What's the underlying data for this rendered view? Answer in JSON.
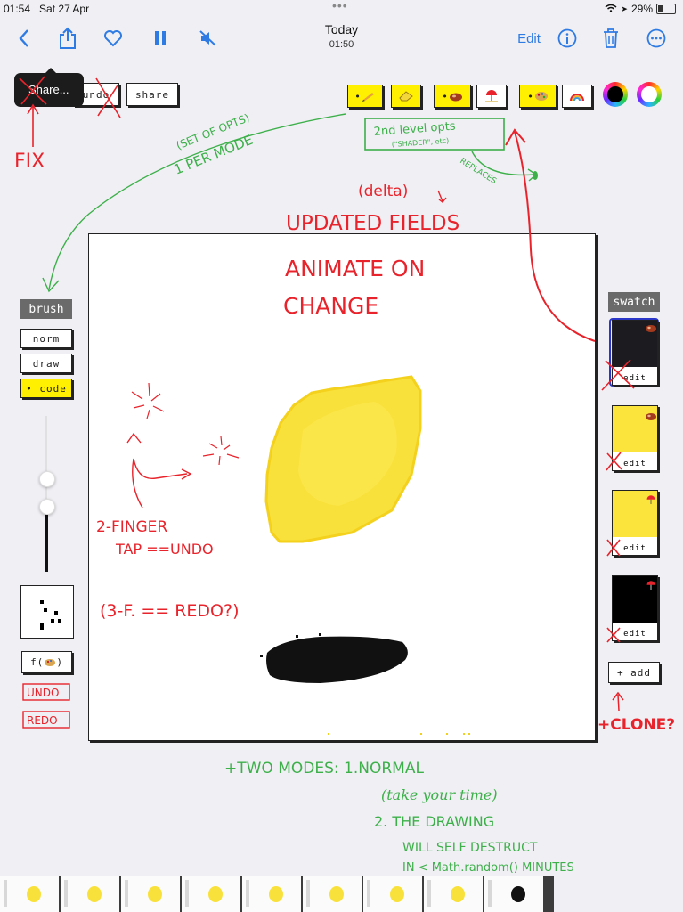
{
  "status_bar": {
    "time": "01:54",
    "date": "Sat 27 Apr",
    "battery": "29%"
  },
  "nav": {
    "title": "Today",
    "subtitle": "01:50",
    "edit_label": "Edit"
  },
  "tooltip": {
    "label": "Share..."
  },
  "toolbar": {
    "undo_label": "undo",
    "share_label": "share"
  },
  "mode_buttons": {
    "pencil": "•",
    "shader": "•",
    "meat": "•"
  },
  "left_panel": {
    "heading": "brush",
    "modes": [
      {
        "label": "norm"
      },
      {
        "label": "draw"
      },
      {
        "label": "• code"
      }
    ],
    "func_label": "f("
  },
  "right_panel": {
    "heading": "swatch",
    "swatches": [
      {
        "edit": "edit"
      },
      {
        "edit": "edit"
      },
      {
        "edit": "edit"
      },
      {
        "edit": "edit"
      }
    ],
    "add_label": "+ add"
  },
  "colors": {
    "accent": "#2f7be4",
    "lemon": "#f9e13b",
    "highlight": "#ffef00",
    "annotation_red": "#e8232b",
    "annotation_green": "#3db04a"
  },
  "annotations": {
    "fix": "FIX",
    "set_of_opts": "(SET OF OPTS)",
    "one_per_mode": "1 PER MODE",
    "second_level": "2nd level opts",
    "shader_etc": "(\"SHADER\", etc)",
    "replaces": "REPLACES",
    "delta": "(delta)",
    "updated_fields": "UPDATED FIELDS",
    "animate": "ANIMATE ON",
    "change": "CHANGE",
    "two_finger": "2-FINGER",
    "tap_undo": "TAP ==UNDO",
    "three_f": "(3-F. == REDO?)",
    "undo": "UNDO",
    "redo": "REDO",
    "clone": "+CLONE?",
    "two_modes": "+TWO MODES: 1.NORMAL",
    "take_time": "(take your time)",
    "self_destruct_1": "2. THE DRAWING",
    "self_destruct_2": "WILL SELF DESTRUCT",
    "self_destruct_3": "IN < Math.random() MINUTES"
  }
}
